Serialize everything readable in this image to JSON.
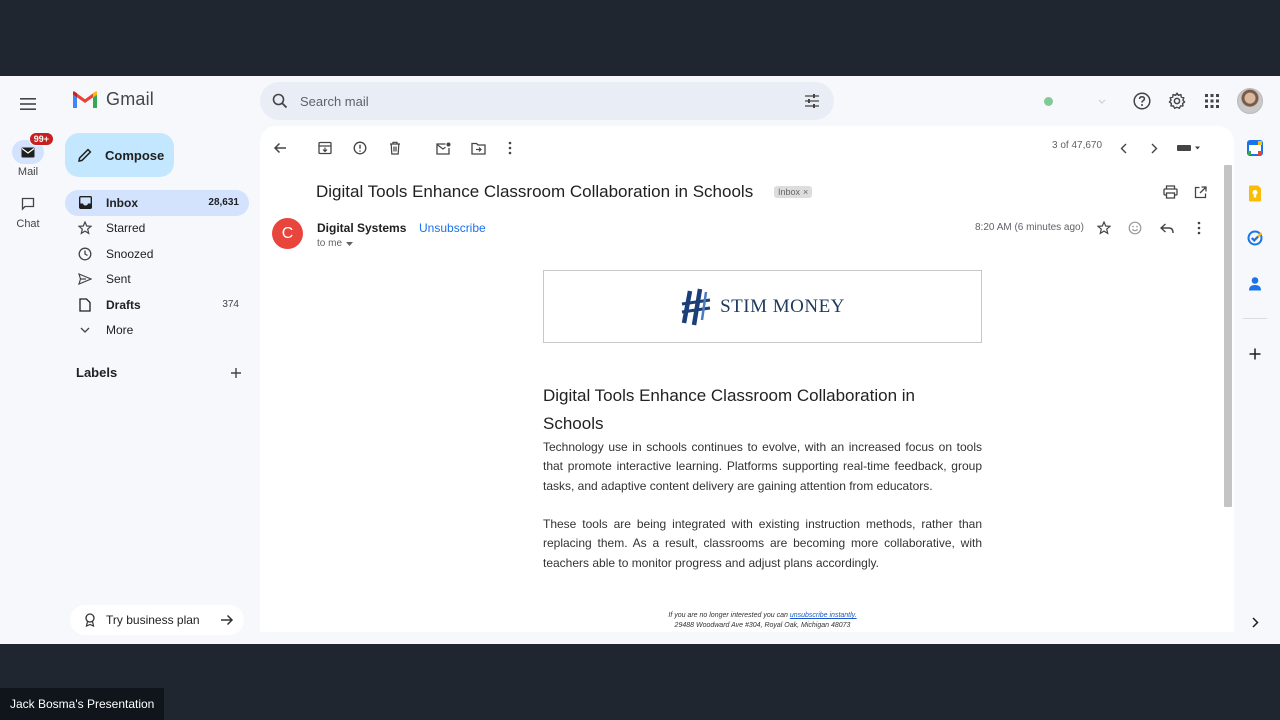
{
  "app": {
    "name": "Gmail",
    "presentation_label": "Jack Bosma's Presentation"
  },
  "rail": {
    "mail_label": "Mail",
    "mail_badge": "99+",
    "chat_label": "Chat"
  },
  "compose_label": "Compose",
  "nav": [
    {
      "label": "Inbox",
      "count": "28,631"
    },
    {
      "label": "Starred",
      "count": ""
    },
    {
      "label": "Snoozed",
      "count": ""
    },
    {
      "label": "Sent",
      "count": ""
    },
    {
      "label": "Drafts",
      "count": "374"
    },
    {
      "label": "More",
      "count": ""
    }
  ],
  "labels_heading": "Labels",
  "try_business": "Try business plan",
  "search": {
    "placeholder": "Search mail"
  },
  "pager": "3 of 47,670",
  "email": {
    "subject": "Digital Tools Enhance Classroom Collaboration in Schools",
    "label_chip": "Inbox",
    "chip_close": "×",
    "sender_initial": "C",
    "sender": "Digital Systems",
    "unsubscribe": "Unsubscribe",
    "to": "to me",
    "time": "8:20 AM (6 minutes ago)",
    "brand": "STIM MONEY",
    "body_title": "Digital Tools Enhance Classroom Collaboration in Schools",
    "paragraphs": [
      "Technology use in schools continues to evolve, with an increased focus on tools that promote interactive learning. Platforms supporting real-time feedback, group tasks, and adaptive content delivery are gaining attention from educators.",
      "These tools are being integrated with existing instruction methods, rather than replacing them. As a result, classrooms are becoming more collaborative, with teachers able to monitor progress and adjust plans accordingly."
    ],
    "footer_text": "If you are no longer interested you can",
    "footer_link": "unsubscribe instantly.",
    "footer_address": "29488 Woodward Ave #304, Royal Oak, Michigan 48073"
  },
  "colors": {
    "accent": "#1a73e8",
    "compose_bg": "#c2e7ff",
    "active_nav": "#d3e3fd",
    "sender_avatar": "#e8453c",
    "brand": "#203a5e"
  },
  "icons": [
    "menu-icon",
    "mail-icon",
    "chat-icon",
    "pencil-icon",
    "inbox-icon",
    "star-icon",
    "clock-icon",
    "send-icon",
    "draft-icon",
    "chevron-down-icon",
    "plus-icon",
    "search-icon",
    "filter-icon",
    "help-icon",
    "gear-icon",
    "apps-icon",
    "back-arrow-icon",
    "archive-icon",
    "report-spam-icon",
    "delete-icon",
    "mark-unread-icon",
    "move-to-icon",
    "more-vert-icon",
    "chevron-left-icon",
    "chevron-right-icon",
    "keyboard-icon",
    "print-icon",
    "open-new-window-icon",
    "emoji-icon",
    "reply-icon",
    "calendar-icon",
    "keep-icon",
    "tasks-icon",
    "contacts-icon",
    "arrow-right-icon",
    "badge-icon"
  ]
}
